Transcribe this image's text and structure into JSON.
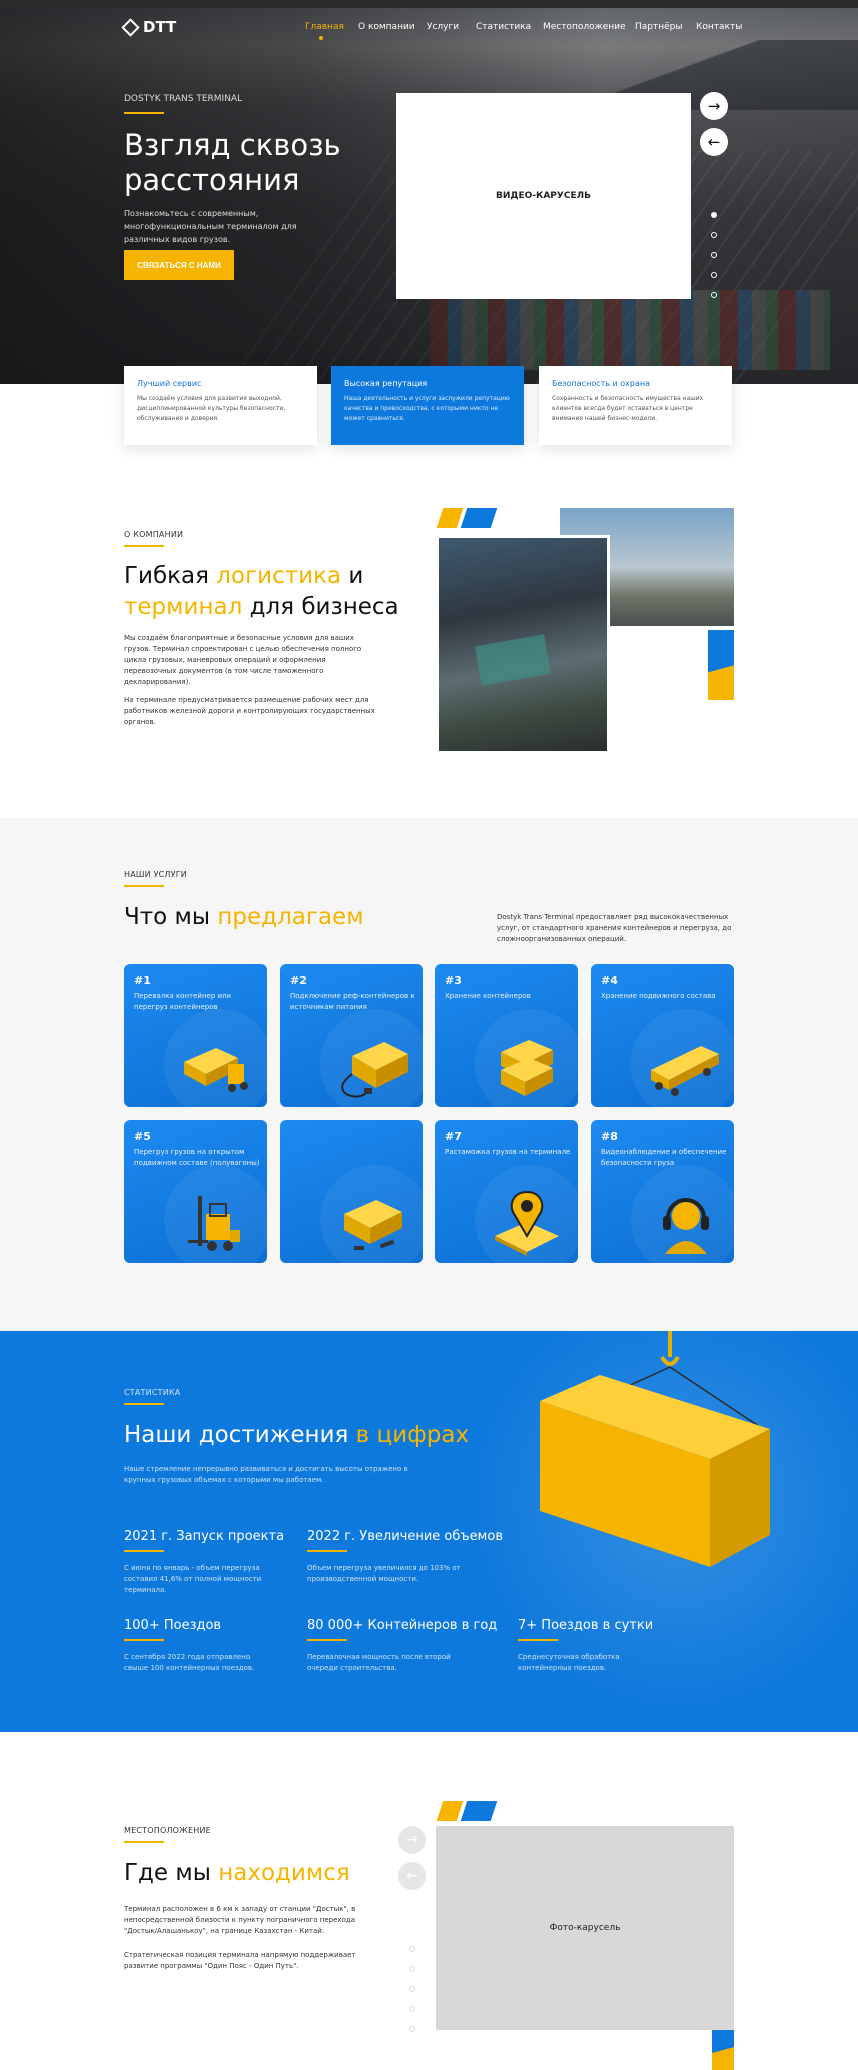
{
  "brand": {
    "name": "DTT"
  },
  "nav": {
    "items": [
      "Главная",
      "О компании",
      "Услуги",
      "Статистика",
      "Местоположение",
      "Партнёры",
      "Контакты"
    ],
    "active": 0
  },
  "hero": {
    "eyebrow": "DOSTYK TRANS TERMINAL",
    "title": "Взгляд сквозь расстояния",
    "subtitle": "Познакомьтесь с современным, многофункциональным терминалом для различных видов грузов.",
    "cta": "СВЯЗАТЬСЯ С НАМИ",
    "video_label": "ВИДЕО-КАРУСЕЛЬ",
    "next_icon": "→",
    "prev_icon": "←",
    "pager_count": 5,
    "pager_active": 0
  },
  "features": [
    {
      "title": "Лучший сервис",
      "text": "Мы создаём условия для развития выходной, дисциплинированной культуры безопасности, обслуживания и доверия."
    },
    {
      "title": "Высокая репутация",
      "text": "Наша деятельность и услуги заслужили репутацию качества и превосходства, с которыми никто не может сравниться."
    },
    {
      "title": "Безопасность и охрана",
      "text": "Сохранность и безопасность имущества наших клиентов всегда будет оставаться в центре внимания нашей бизнес-модели."
    }
  ],
  "about": {
    "eyebrow": "О КОМПАНИИ",
    "title_a": "Гибкая ",
    "title_b": "логистика",
    "title_c": " и",
    "title_d": "терминал",
    "title_e": " для бизнеса",
    "p1": "Мы создаём благоприятные и безопасные условия для ваших грузов. Терминал спроектирован с целью обеспечения полного цикла грузовых, маневровых операций и оформления перевозочных документов (в том числе таможенного декларирования).",
    "p2": "На терминале предусматривается размещение рабочих мест для работников железной дороги и контролирующих государственных органов."
  },
  "services": {
    "eyebrow": "НАШИ УСЛУГИ",
    "title_a": "Что мы ",
    "title_b": "предлагаем",
    "desc": "Dostyk Trans Terminal предоставляет ряд высококачественных услуг, от стандартного хранения контейнеров и перегруза, до сложноорганизованных операций.",
    "items": [
      {
        "num": "#1",
        "title": "Перевалка контейнер или перегруз контейнеров",
        "icon": "forklift-container-icon"
      },
      {
        "num": "#2",
        "title": "Подключение реф-контейнеров к источникам питания",
        "icon": "reefer-plug-icon"
      },
      {
        "num": "#3",
        "title": "Хранение контейнеров",
        "icon": "container-stack-icon"
      },
      {
        "num": "#4",
        "title": "Хранение подвижного состава",
        "icon": "railcar-icon"
      },
      {
        "num": "#5",
        "title": "Перегруз грузов на открытом подвижном составе (полувагоны)",
        "icon": "forklift-icon"
      },
      {
        "num": "",
        "title": "",
        "icon": "container-tools-icon"
      },
      {
        "num": "#7",
        "title": "Растаможка грузов на терминале",
        "icon": "location-pin-icon"
      },
      {
        "num": "#8",
        "title": "Видеонаблюдение и обеспечение безопасности груза",
        "icon": "headset-icon"
      }
    ]
  },
  "stats": {
    "eyebrow": "СТАТИСТИКА",
    "title_a": "Наши достижения ",
    "title_b": "в цифрах",
    "desc": "Наше стремление непрерывно развиваться и достигать высоты отражено в крупных грузовых объемах с которыми мы работаем.",
    "items": [
      {
        "h": "2021 г. Запуск проекта",
        "p": "С июня по январь - объем перегруза составил 41,6% от полной мощности терминала."
      },
      {
        "h": "2022 г. Увеличение объемов",
        "p": "Объем перегруза увеличился до 103% от производственной мощности."
      },
      {
        "h": "100+ Поездов",
        "p": "С сентября 2022 года отправлено свыше 100 контейнерных поездов."
      },
      {
        "h": "80 000+ Контейнеров в год",
        "p": "Перевалочная мощность после второй очереди строительства."
      },
      {
        "h": "7+ Поездов в сутки",
        "p": "Среднесуточная обработка контейнерных поездов."
      }
    ]
  },
  "location": {
    "eyebrow": "МЕСТОПОЛОЖЕНИЕ",
    "title_a": "Где мы ",
    "title_b": "находимся",
    "p1": "Терминал расположен в 6 км к западу от станции \"Достык\", в непосредственной близости к пункту пограничного перехода \"Достык/Алашанькоу\", на границе Казахстан - Китай.",
    "p2": "Стратегическая позиция терминала напрямую поддерживает развитие программы \"Один Пояс - Один Путь\".",
    "photo_label": "Фото-карусель",
    "next_icon": "→",
    "prev_icon": "←",
    "pager_count": 5
  },
  "colors": {
    "accent": "#f5b400",
    "brand_blue": "#0e79dc",
    "dark": "#111111"
  }
}
